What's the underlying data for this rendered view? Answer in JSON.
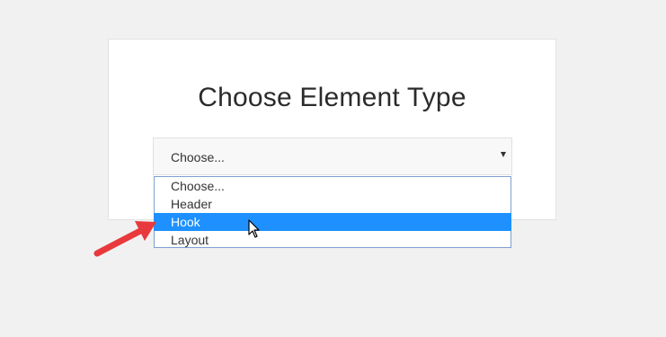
{
  "dialog": {
    "title": "Choose Element Type"
  },
  "element_type_select": {
    "value": "Choose...",
    "options": [
      {
        "label": "Choose..."
      },
      {
        "label": "Header"
      },
      {
        "label": "Hook"
      },
      {
        "label": "Layout"
      }
    ],
    "highlighted": "Hook"
  },
  "icons": {
    "caret": "caret-down-icon",
    "annotation": "red-arrow-icon",
    "pointer": "mouse-cursor-icon"
  },
  "colors": {
    "page_bg": "#f1f1f1",
    "card_bg": "#ffffff",
    "highlight": "#1e90ff",
    "dropdown_border": "#7e9fd0",
    "annotation_arrow": "#e8393d"
  }
}
